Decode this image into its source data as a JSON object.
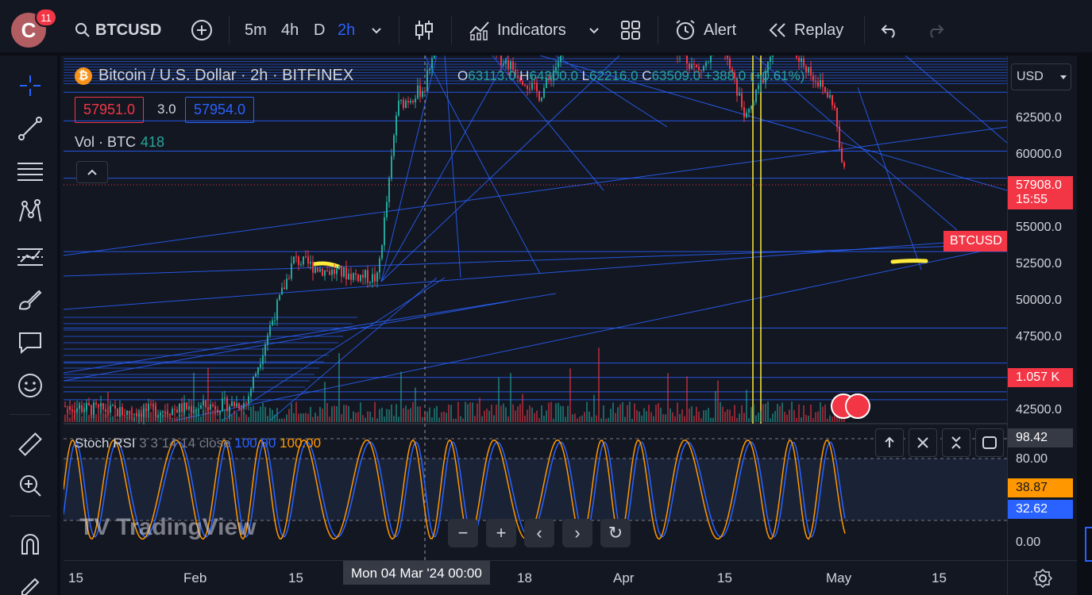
{
  "user": {
    "initial": "C",
    "notifications": "11"
  },
  "toolbar": {
    "symbol": "BTCUSD",
    "intervals": [
      "5m",
      "4h",
      "D",
      "2h"
    ],
    "active_interval": "2h",
    "indicators_label": "Indicators",
    "alert_label": "Alert",
    "replay_label": "Replay"
  },
  "legend": {
    "title": "Bitcoin / U.S. Dollar · 2h · BITFINEX",
    "open_key": "O",
    "open": "63113.0",
    "high_key": "H",
    "high": "64300.0",
    "low_key": "L",
    "low": "62216.0",
    "close_key": "C",
    "close": "63509.0",
    "change": "+388.0 (+0.61%)",
    "sell": "57951.0",
    "spread": "3.0",
    "buy": "57954.0",
    "volume_label": "Vol · BTC",
    "volume_value": "418"
  },
  "stoch": {
    "name": "Stoch RSI",
    "params": "3 3 14 14 close",
    "k_value": "100.00",
    "d_value": "100.00"
  },
  "price_axis": {
    "currency": "USD",
    "labels": [
      "62500.0",
      "60000.0",
      "55000.0",
      "52500.0",
      "50000.0",
      "47500.0",
      "42500.0"
    ],
    "symbol_tag": "BTCUSD",
    "current_price": "57908.0",
    "countdown": "15:55",
    "volume_tag": "1.057 K",
    "stoch_labels": [
      "98.42",
      "80.00",
      "0.00"
    ],
    "stoch_k_tag": "38.87",
    "stoch_d_tag": "32.62"
  },
  "time_axis": {
    "labels": [
      "15",
      "Feb",
      "15",
      "18",
      "Apr",
      "15",
      "May",
      "15"
    ],
    "cursor_label": "Mon 04 Mar '24   00:00"
  },
  "watermark": "TradingView",
  "colors": {
    "background": "#131722",
    "up": "#26a69a",
    "down": "#f23645",
    "drawing_lines": "#2962ff",
    "highlight": "#ffeb3b",
    "stoch_k": "#ff9800",
    "stoch_d": "#2962ff",
    "accent": "#2962ff"
  },
  "chart_data": {
    "type": "candlestick",
    "symbol": "BTCUSD",
    "exchange": "BITFINEX",
    "interval": "2h",
    "x": [
      "Jan 15",
      "Feb",
      "Feb 15",
      "Mar 04",
      "Mar 18",
      "Apr",
      "Apr 15",
      "May",
      "May 15"
    ],
    "close_approx": [
      42500,
      43000,
      52000,
      63000,
      65000,
      69000,
      63500,
      60000,
      null
    ],
    "ylim": [
      42000,
      65000
    ],
    "last_price": 57908.0,
    "stochrsi_range": [
      0,
      100
    ],
    "stochrsi_levels": [
      20,
      80
    ]
  }
}
